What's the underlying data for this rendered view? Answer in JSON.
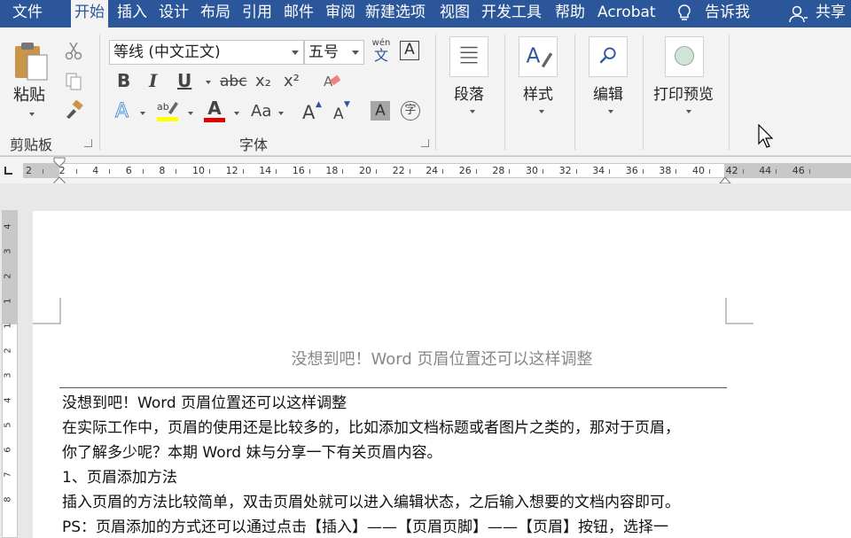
{
  "tabs": [
    {
      "label": "文件",
      "active": false
    },
    {
      "label": "开始",
      "active": true
    },
    {
      "label": "插入",
      "active": false
    },
    {
      "label": "设计",
      "active": false
    },
    {
      "label": "布局",
      "active": false
    },
    {
      "label": "引用",
      "active": false
    },
    {
      "label": "邮件",
      "active": false
    },
    {
      "label": "审阅",
      "active": false
    },
    {
      "label": "新建选项",
      "active": false
    },
    {
      "label": "视图",
      "active": false
    },
    {
      "label": "开发工具",
      "active": false
    },
    {
      "label": "帮助",
      "active": false
    },
    {
      "label": "Acrobat",
      "active": false
    }
  ],
  "tell_me": "告诉我",
  "share": "共享",
  "ribbon": {
    "clipboard": {
      "paste_label": "粘贴",
      "group_label": "剪贴板"
    },
    "font": {
      "font_name": "等线 (中文正文)",
      "font_size": "五号",
      "phonetic_label": "wén",
      "phonetic_char": "文",
      "char_border": "A",
      "bold": "B",
      "italic": "I",
      "underline": "U",
      "strike": "abc",
      "subscript": "x₂",
      "superscript": "x²",
      "text_effects": "A",
      "font_color_glyph": "A",
      "change_case": "Aa",
      "grow_font": "A",
      "shrink_font": "A",
      "char_shading": "A",
      "enclose_char": "字",
      "group_label": "字体",
      "highlight_color": "#ffff00",
      "font_color": "#e00000"
    },
    "paragraph_label": "段落",
    "styles_label": "样式",
    "editing_label": "编辑",
    "print_preview_label": "打印预览"
  },
  "ruler": {
    "numbers": [
      "2",
      "2",
      "4",
      "6",
      "8",
      "10",
      "12",
      "14",
      "16",
      "18",
      "20",
      "22",
      "24",
      "26",
      "28",
      "30",
      "32",
      "34",
      "36",
      "38",
      "40",
      "42",
      "44",
      "46"
    ],
    "vertical_numbers": [
      "4",
      "3",
      "2",
      "1",
      "1",
      "2",
      "3",
      "4",
      "5",
      "6",
      "7",
      "8"
    ]
  },
  "document": {
    "header_text": "没想到吧！Word 页眉位置还可以这样调整",
    "lines": [
      "没想到吧！Word 页眉位置还可以这样调整",
      "在实际工作中，页眉的使用还是比较多的，比如添加文档标题或者图片之类的，那对于页眉，",
      "你了解多少呢？本期 Word 妹与分享一下有关页眉内容。",
      "1、页眉添加方法",
      "插入页眉的方法比较简单，双击页眉处就可以进入编辑状态，之后输入想要的文档内容即可。",
      "PS：页眉添加的方式还可以通过点击【插入】——【页眉页脚】——【页眉】按钮，选择一"
    ]
  }
}
